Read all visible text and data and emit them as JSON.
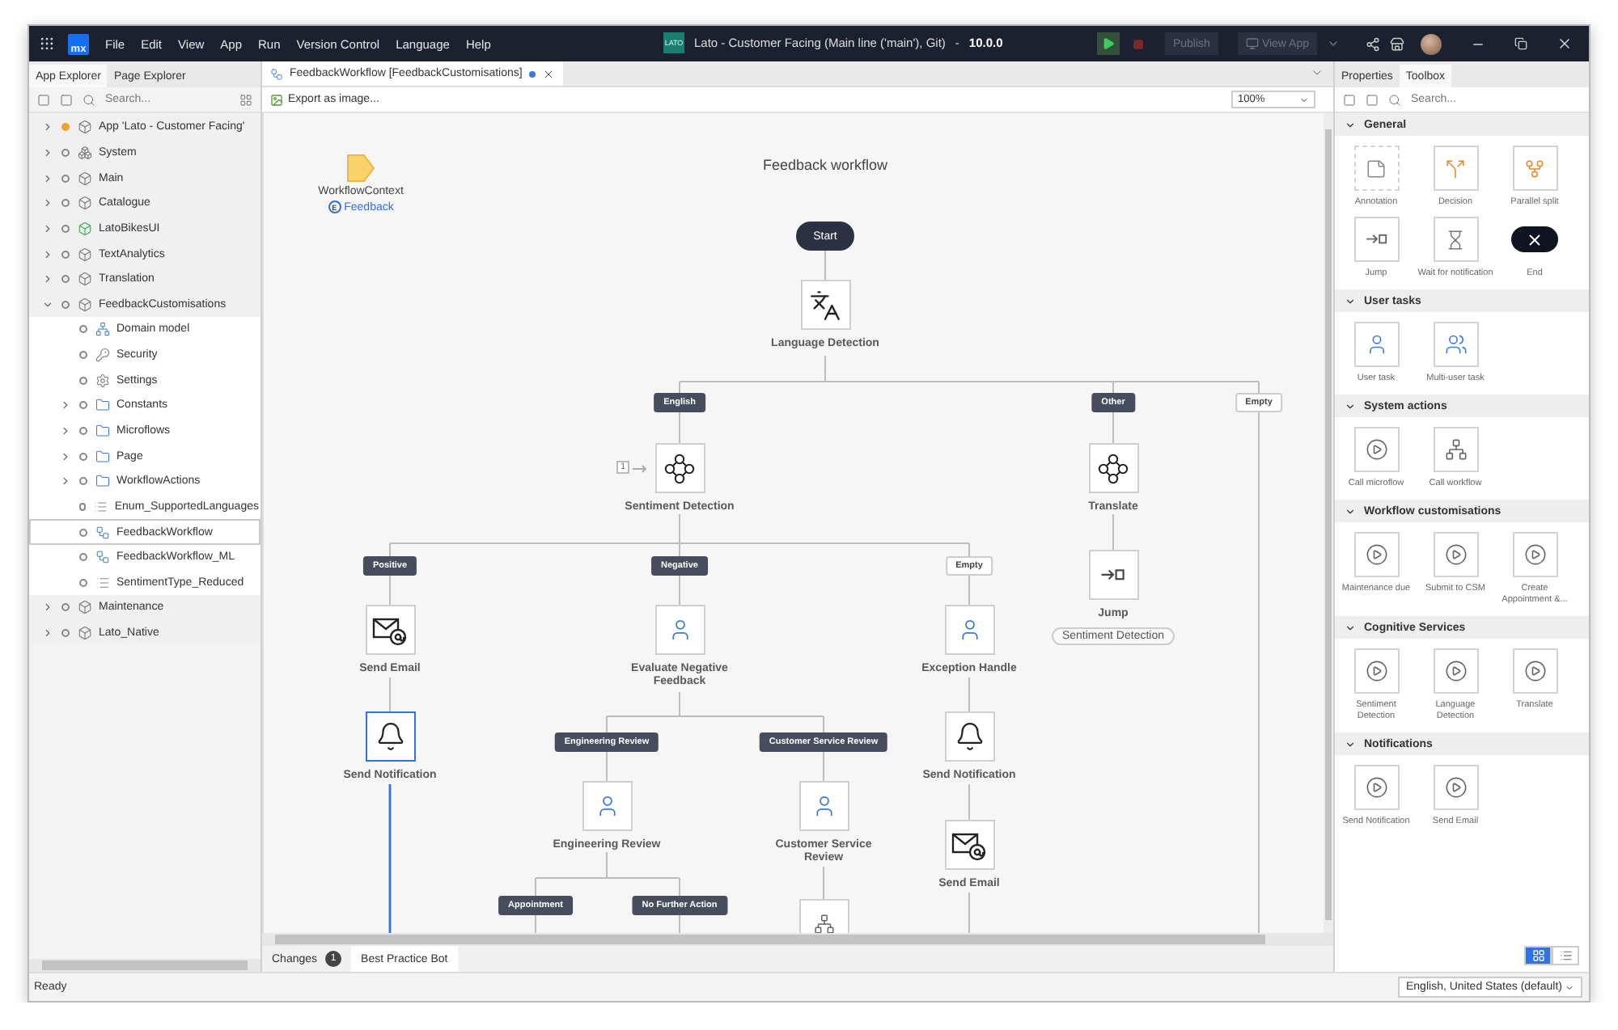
{
  "title_bar": {
    "logo": "mx",
    "menus": [
      "File",
      "Edit",
      "View",
      "App",
      "Run",
      "Version Control",
      "Language",
      "Help"
    ],
    "app_badge": "LATO",
    "title": "Lato - Customer Facing (Main line ('main'), Git)",
    "separator": "-",
    "version": "10.0.0",
    "buttons": [
      {
        "label": "Publish",
        "disabled": true
      },
      {
        "label": "View App",
        "disabled": true
      }
    ]
  },
  "left_panel": {
    "tabs": [
      {
        "label": "App Explorer",
        "selected": true
      },
      {
        "label": "Page Explorer",
        "selected": false
      }
    ],
    "search": {
      "placeholder": "Search..."
    },
    "tree": [
      {
        "label": "App 'Lato - Customer Facing'",
        "kind": "app",
        "modified": true,
        "selected": false,
        "expanded": false
      },
      {
        "label": "System",
        "kind": "system",
        "modified": false,
        "selected": false,
        "expanded": false
      },
      {
        "label": "Main",
        "kind": "module",
        "modified": false,
        "selected": false,
        "expanded": false
      },
      {
        "label": "Catalogue",
        "kind": "module",
        "modified": false,
        "selected": false,
        "expanded": false
      },
      {
        "label": "LatoBikesUI",
        "kind": "ui-module",
        "modified": false,
        "selected": false,
        "expanded": false
      },
      {
        "label": "TextAnalytics",
        "kind": "module",
        "modified": false,
        "selected": false,
        "expanded": false
      },
      {
        "label": "Translation",
        "kind": "module",
        "modified": false,
        "selected": false,
        "expanded": false
      },
      {
        "label": "FeedbackCustomisations",
        "kind": "module",
        "modified": false,
        "selected": false,
        "expanded": true,
        "children": [
          {
            "label": "Domain model",
            "kind": "domain",
            "modified": false,
            "selected": false
          },
          {
            "label": "Security",
            "kind": "security",
            "modified": false,
            "selected": false
          },
          {
            "label": "Settings",
            "kind": "settings",
            "modified": false,
            "selected": false
          },
          {
            "label": "Constants",
            "kind": "folder",
            "modified": false,
            "selected": false,
            "expanded": false
          },
          {
            "label": "Microflows",
            "kind": "folder",
            "modified": false,
            "selected": false,
            "expanded": false
          },
          {
            "label": "Page",
            "kind": "folder",
            "modified": false,
            "selected": false,
            "expanded": false
          },
          {
            "label": "WorkflowActions",
            "kind": "folder",
            "modified": false,
            "selected": false,
            "expanded": false
          },
          {
            "label": "Enum_SupportedLanguages",
            "kind": "enum",
            "modified": false,
            "selected": false
          },
          {
            "label": "FeedbackWorkflow",
            "kind": "workflow",
            "modified": false,
            "selected": true
          },
          {
            "label": "FeedbackWorkflow_ML",
            "kind": "workflow",
            "modified": false,
            "selected": false
          },
          {
            "label": "SentimentType_Reduced",
            "kind": "enum",
            "modified": false,
            "selected": false
          }
        ]
      },
      {
        "label": "Maintenance",
        "kind": "module",
        "modified": false,
        "selected": false,
        "expanded": false
      },
      {
        "label": "Lato_Native",
        "kind": "module",
        "modified": false,
        "selected": false,
        "expanded": false
      }
    ]
  },
  "editor": {
    "tab": {
      "label": "FeedbackWorkflow [FeedbackCustomisations]",
      "modified": true
    },
    "toolbar": {
      "export": "Export as image...",
      "zoom": "100%"
    },
    "workflow": {
      "title": "Feedback workflow",
      "context": {
        "name": "WorkflowContext",
        "entity_badge": "E",
        "entity": "Feedback"
      },
      "nodes": [
        {
          "kind": "start",
          "label": "Start",
          "selected": false
        },
        {
          "kind": "translate",
          "label": "Language Detection",
          "selected": false
        },
        {
          "kind": "sentiment",
          "label": "Sentiment Detection",
          "selected": false,
          "badge": "1"
        },
        {
          "kind": "sentiment",
          "label": "Translate",
          "selected": false
        },
        {
          "kind": "jump",
          "label": "Jump",
          "selected": false,
          "target": "Sentiment Detection"
        },
        {
          "kind": "email",
          "label": "Send Email",
          "selected": false
        },
        {
          "kind": "user",
          "label": "Evaluate Negative Feedback",
          "selected": false
        },
        {
          "kind": "user",
          "label": "Exception Handle",
          "selected": false
        },
        {
          "kind": "notification",
          "label": "Send Notification",
          "selected": true
        },
        {
          "kind": "notification",
          "label": "Send Notification",
          "selected": false
        },
        {
          "kind": "email",
          "label": "Send Email",
          "selected": false
        },
        {
          "kind": "user",
          "label": "Engineering Review",
          "selected": false
        },
        {
          "kind": "user",
          "label": "Customer Service Review",
          "selected": false
        },
        {
          "kind": "call",
          "selected": false
        }
      ],
      "branch_labels": [
        {
          "label": "English",
          "kind": "outcome"
        },
        {
          "label": "Other",
          "kind": "outcome"
        },
        {
          "label": "Empty",
          "kind": "empty"
        },
        {
          "label": "Positive",
          "kind": "outcome"
        },
        {
          "label": "Negative",
          "kind": "outcome"
        },
        {
          "label": "Empty",
          "kind": "empty"
        },
        {
          "label": "Engineering Review",
          "kind": "outcome"
        },
        {
          "label": "Customer Service Review",
          "kind": "outcome"
        },
        {
          "label": "Appointment",
          "kind": "outcome"
        },
        {
          "label": "No Further Action",
          "kind": "outcome"
        }
      ]
    }
  },
  "bottom_tabs": [
    {
      "label": "Changes",
      "count": "1",
      "selected": false
    },
    {
      "label": "Best Practice Bot",
      "selected": true
    }
  ],
  "right_panel": {
    "tabs": [
      {
        "label": "Properties",
        "selected": false
      },
      {
        "label": "Toolbox",
        "selected": true
      }
    ],
    "search": {
      "placeholder": "Search..."
    },
    "sections": [
      {
        "title": "General",
        "expanded": true,
        "items": [
          {
            "label": "Annotation",
            "kind": "annotation"
          },
          {
            "label": "Decision",
            "kind": "decision"
          },
          {
            "label": "Parallel split",
            "kind": "parallel"
          },
          {
            "label": "Jump",
            "kind": "jump"
          },
          {
            "label": "Wait for notification",
            "kind": "wait"
          },
          {
            "label": "End",
            "kind": "end"
          }
        ]
      },
      {
        "title": "User tasks",
        "expanded": true,
        "items": [
          {
            "label": "User task",
            "kind": "user"
          },
          {
            "label": "Multi-user task",
            "kind": "multi-user"
          }
        ]
      },
      {
        "title": "System actions",
        "expanded": true,
        "items": [
          {
            "label": "Call microflow",
            "kind": "microflow"
          },
          {
            "label": "Call workflow",
            "kind": "call"
          }
        ]
      },
      {
        "title": "Workflow customisations",
        "expanded": true,
        "items": [
          {
            "label": "Maintenance due",
            "kind": "microflow"
          },
          {
            "label": "Submit to CSM",
            "kind": "microflow"
          },
          {
            "label": "Create Appointment &...",
            "kind": "microflow"
          }
        ]
      },
      {
        "title": "Cognitive Services",
        "expanded": true,
        "items": [
          {
            "label": "Sentiment Detection",
            "kind": "microflow"
          },
          {
            "label": "Language Detection",
            "kind": "microflow"
          },
          {
            "label": "Translate",
            "kind": "microflow"
          }
        ]
      },
      {
        "title": "Notifications",
        "expanded": true,
        "items": [
          {
            "label": "Send Notification",
            "kind": "microflow"
          },
          {
            "label": "Send Email",
            "kind": "microflow"
          }
        ]
      }
    ],
    "view_modes": [
      {
        "kind": "grid",
        "selected": true
      },
      {
        "kind": "list",
        "selected": false
      }
    ]
  },
  "status_bar": {
    "text": "Ready",
    "language": "English, United States (default)"
  }
}
